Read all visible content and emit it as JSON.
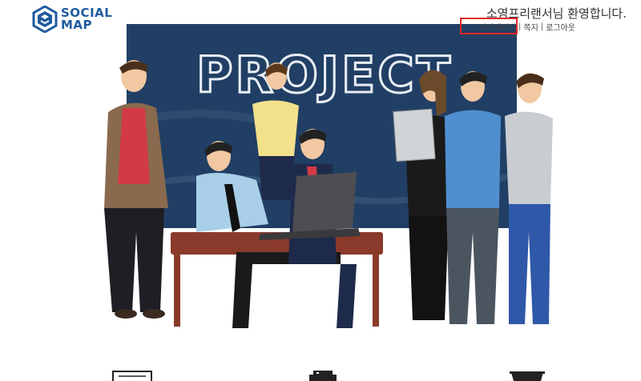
{
  "brand": {
    "line1": "SOCIAL",
    "line2": "MAP",
    "color": "#1f5a9e"
  },
  "header": {
    "welcome": "소영프리랜서님 환영합니다.",
    "nav": {
      "mypage": "마이페이지",
      "separator1": "|",
      "message": "쪽지",
      "separator2": "|",
      "logout": "로그아웃"
    }
  },
  "hero": {
    "board_text": "PROJECT",
    "board_color": "#1c3a5e"
  },
  "features": {
    "icons": [
      "document-icon",
      "printer-icon",
      "trophy-icon"
    ]
  },
  "colors": {
    "highlight": "#e3262a",
    "text": "#333333"
  }
}
